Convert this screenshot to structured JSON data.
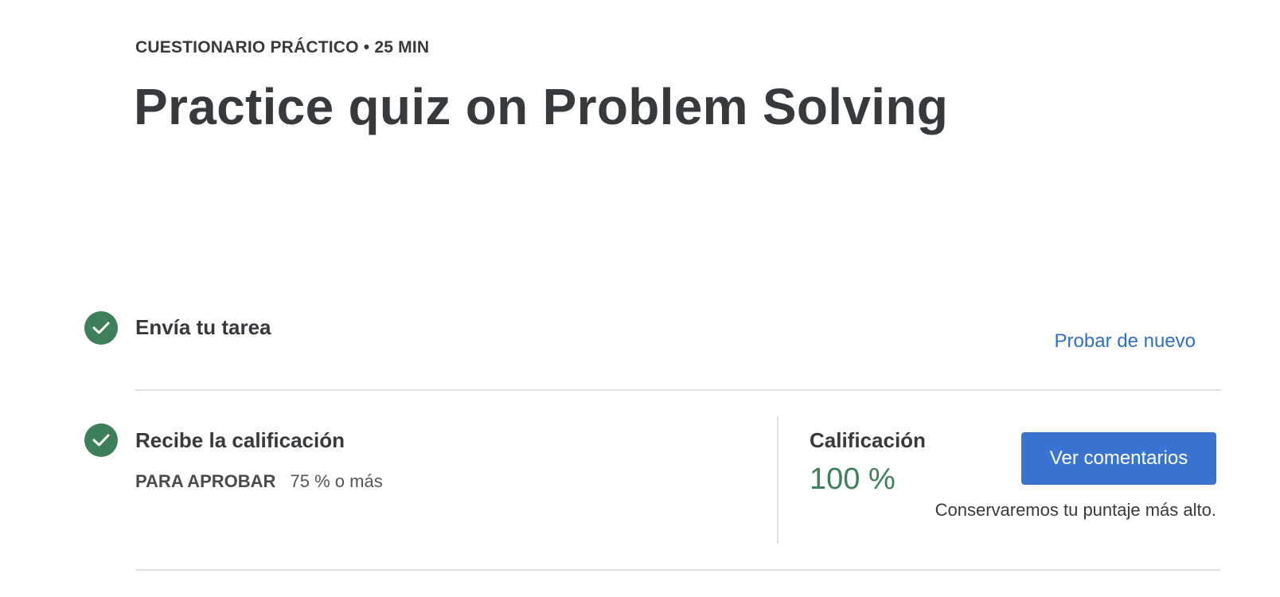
{
  "header": {
    "eyebrow": "CUESTIONARIO PRÁCTICO • 25 MIN",
    "title": "Practice quiz on Problem Solving"
  },
  "steps": [
    {
      "title": "Envía tu tarea",
      "status_icon": "check-circle-icon",
      "action_label": "Probar de nuevo"
    },
    {
      "title": "Recibe la calificación",
      "status_icon": "check-circle-icon",
      "pass_label": "PARA APROBAR",
      "pass_value": "75 % o más"
    }
  ],
  "grade": {
    "label": "Calificación",
    "value": "100 %",
    "button_label": "Ver comentarios",
    "note": "Conservaremos tu puntaje más alto."
  },
  "colors": {
    "success": "#3c7f58",
    "link": "#2f6fc6",
    "primary_button": "#3a74d1",
    "text": "#373a3c",
    "divider": "#e1e1e1"
  }
}
